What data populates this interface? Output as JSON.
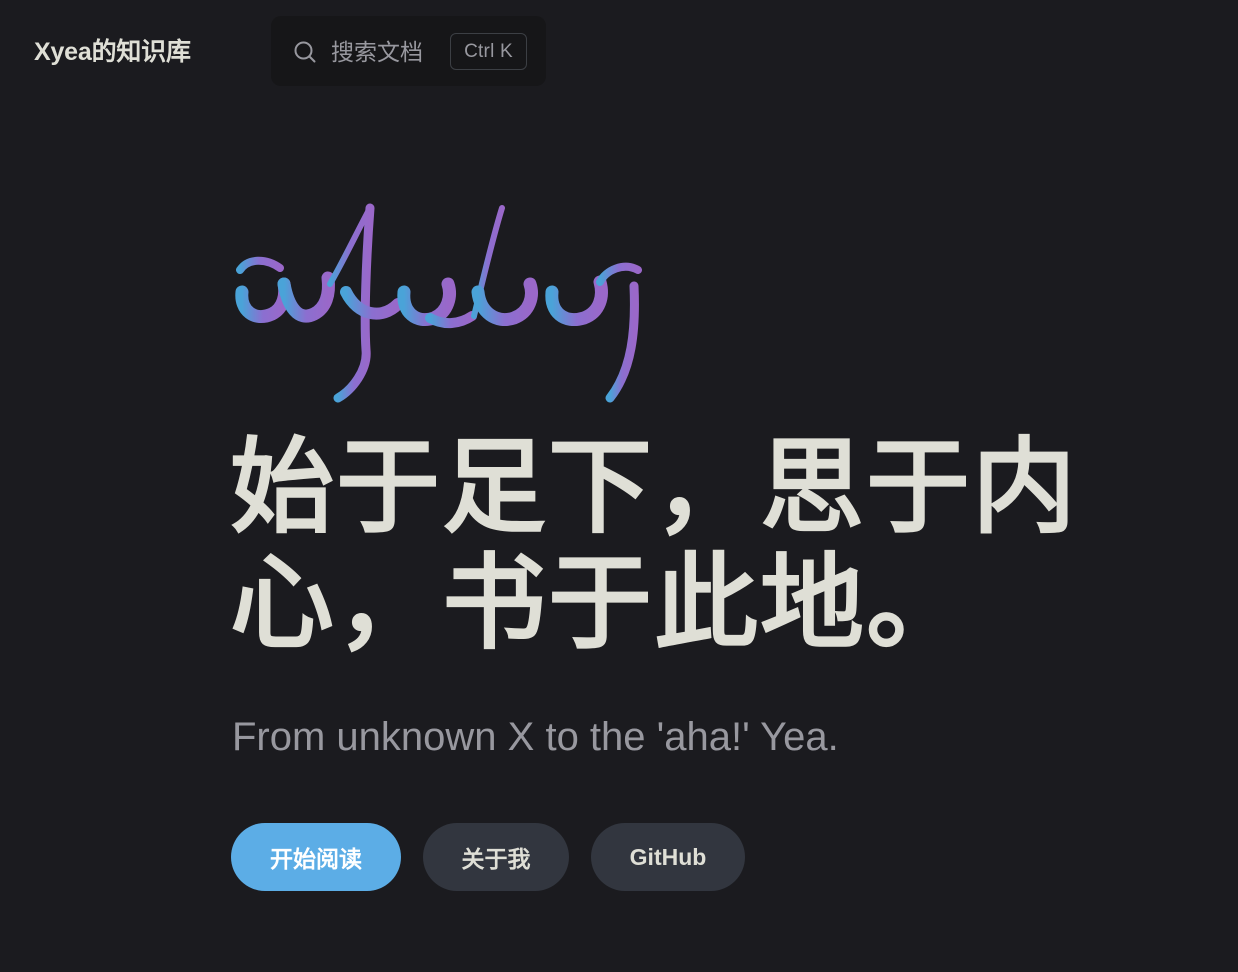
{
  "navbar": {
    "site_title": "Xyea的知识库",
    "search": {
      "placeholder": "搜索文档",
      "shortcut": "Ctrl K",
      "icon": "search-icon"
    }
  },
  "hero": {
    "logo_text": "xyea",
    "logo_gradient": [
      "#4aa3d8",
      "#8b6fd0",
      "#9a68c9"
    ],
    "tagline": "始于足下，思于内心，书于此地。",
    "subtitle": "From unknown X to the 'aha!' Yea.",
    "actions": [
      {
        "label": "开始阅读",
        "theme": "brand"
      },
      {
        "label": "关于我",
        "theme": "alt"
      },
      {
        "label": "GitHub",
        "theme": "alt"
      }
    ]
  },
  "colors": {
    "background": "#1b1b1f",
    "brand": "#5cade6",
    "alt_button": "#32363f",
    "text_primary": "#dfdfd6",
    "text_muted": "#98989f"
  }
}
